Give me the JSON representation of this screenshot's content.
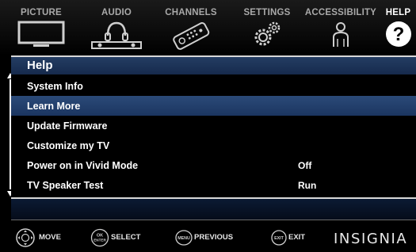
{
  "tabs": [
    {
      "id": "picture",
      "label": "PICTURE",
      "icon": "tv-icon",
      "active": false
    },
    {
      "id": "audio",
      "label": "AUDIO",
      "icon": "headphones-icon",
      "active": false
    },
    {
      "id": "channels",
      "label": "CHANNELS",
      "icon": "remote-icon",
      "active": false
    },
    {
      "id": "settings",
      "label": "SETTINGS",
      "icon": "gears-icon",
      "active": false
    },
    {
      "id": "accessibility",
      "label": "ACCESSIBILITY",
      "icon": "person-icon",
      "active": false
    },
    {
      "id": "help",
      "label": "HELP",
      "icon": "question-icon",
      "active": true
    }
  ],
  "menu": {
    "title": "Help",
    "items": [
      {
        "label": "System Info",
        "value": "",
        "selected": false
      },
      {
        "label": "Learn More",
        "value": "",
        "selected": true
      },
      {
        "label": "Update Firmware",
        "value": "",
        "selected": false
      },
      {
        "label": "Customize my TV",
        "value": "",
        "selected": false
      },
      {
        "label": "Power on in Vivid Mode",
        "value": "Off",
        "selected": false
      },
      {
        "label": "TV Speaker Test",
        "value": "Run",
        "selected": false
      }
    ]
  },
  "footer": {
    "hints": [
      {
        "button": "dpad-icon",
        "button_text": "",
        "label": "MOVE"
      },
      {
        "button": "ok-button-icon",
        "button_text": "OK ENTER",
        "label": "SELECT"
      },
      {
        "button": "menu-button-icon",
        "button_text": "MENU",
        "label": "PREVIOUS"
      },
      {
        "button": "exit-button-icon",
        "button_text": "EXIT",
        "label": "EXIT"
      }
    ],
    "brand": "INSIGNIA"
  },
  "colors": {
    "header_blue": "#1c3356",
    "selected_blue": "#234173",
    "tab_inactive": "#a9a9a9",
    "tab_active": "#ffffff"
  }
}
